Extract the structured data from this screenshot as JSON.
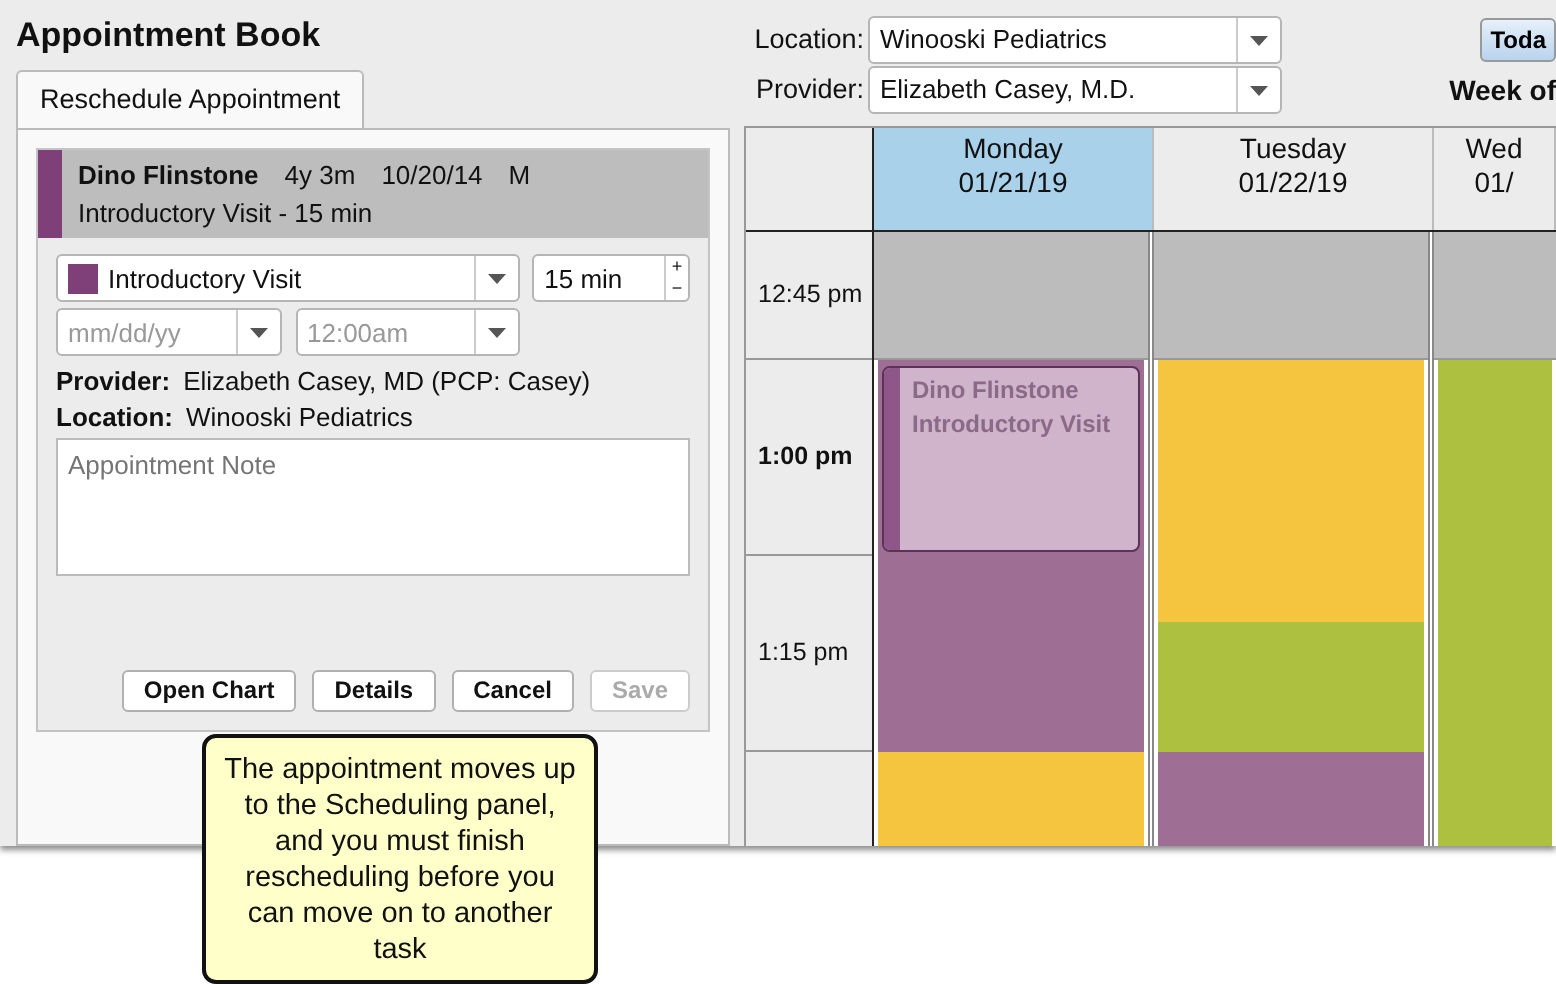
{
  "window": {
    "title": "Appointment Book"
  },
  "tabs": [
    {
      "label": "Reschedule Appointment",
      "selected": true
    }
  ],
  "appointment": {
    "patient": "Dino Flinstone",
    "age": "4y 3m",
    "dob": "10/20/14",
    "sex": "M",
    "visit": "Introductory Visit - 15 min",
    "color": "#7f3f78"
  },
  "form": {
    "visit_type": {
      "value": "Introductory Visit",
      "color": "#7f3f78"
    },
    "duration": "15 min",
    "spinner": {
      "up": "+",
      "down": "−"
    },
    "date": {
      "placeholder": "mm/dd/yy"
    },
    "time": {
      "placeholder": "12:00am"
    },
    "provider_label": "Provider:",
    "provider": "Elizabeth Casey, MD (PCP: Casey)",
    "location_label": "Location:",
    "location": "Winooski Pediatrics",
    "note": {
      "placeholder": "Appointment Note"
    }
  },
  "buttons": [
    {
      "label": "Open Chart",
      "disabled": false
    },
    {
      "label": "Details",
      "disabled": false
    },
    {
      "label": "Cancel",
      "disabled": false
    },
    {
      "label": "Save",
      "disabled": true
    }
  ],
  "filters": [
    {
      "label": "Location:",
      "value": "Winooski Pediatrics"
    },
    {
      "label": "Provider:",
      "value": "Elizabeth Casey, M.D."
    }
  ],
  "today_button": "Toda",
  "week_label": "Week of",
  "calendar": {
    "days": [
      {
        "name": "Monday",
        "date": "01/21/19",
        "selected": true,
        "events": [
          {
            "color": "#9f6e94"
          },
          {
            "color": "#f5c540"
          }
        ]
      },
      {
        "name": "Tuesday",
        "date": "01/22/19",
        "selected": false,
        "events": [
          {
            "color": "#f5c540"
          },
          {
            "color": "#aec03f"
          },
          {
            "color": "#9f6e94"
          }
        ]
      },
      {
        "name": "Wed",
        "date": "01/",
        "selected": false,
        "events": [
          {
            "color": "#aec03f"
          }
        ]
      }
    ],
    "times": [
      {
        "label": "12:45 pm",
        "bold": false,
        "available": false
      },
      {
        "label": "1:00 pm",
        "bold": true,
        "available": true
      },
      {
        "label": "1:15 pm",
        "bold": false,
        "available": true
      }
    ],
    "moving_appointment": {
      "lines": [
        "Dino Flinstone",
        "Introductory Visit"
      ],
      "color": "#8f5689"
    }
  },
  "callout": {
    "text": "The appointment moves up to the Scheduling panel, and you must finish rescheduling before you can move on to another task"
  }
}
